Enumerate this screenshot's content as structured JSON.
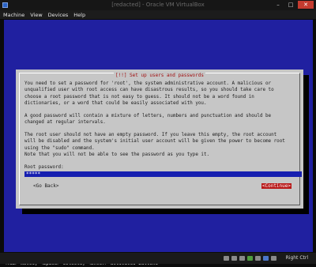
{
  "window": {
    "title": "[redacted] - Oracle VM VirtualBox",
    "controls": {
      "minimize": "–",
      "maximize": "□",
      "close": "✕"
    }
  },
  "menu": [
    "Machine",
    "View",
    "Devices",
    "Help"
  ],
  "dialog": {
    "title": "[!!] Set up users and passwords",
    "paragraphs": [
      "You need to set a password for 'root', the system administrative account. A malicious or unqualified user with root access can have disastrous results, so you should take care to choose a root password that is not easy to guess. It should not be a word found in dictionaries, or a word that could be easily associated with you.",
      "A good password will contain a mixture of letters, numbers and punctuation and should be changed at regular intervals.",
      "The root user should not have an empty password. If you leave this empty, the root account will be disabled and the system's initial user account will be given the power to become root using the \"sudo\" command.",
      "Note that you will not be able to see the password as you type it."
    ],
    "field_label": "Root password:",
    "field_value": "*****",
    "back_label": "<Go Back>",
    "continue_label": "<Continue>"
  },
  "status_line": "<Tab> moves; <Space> selects; <Enter> activates buttons",
  "host_key": "Right Ctrl",
  "colors": {
    "screen_bg": "#2020a0",
    "dialog_bg": "#c6c6c6",
    "title_red": "#a01010",
    "button_selected": "#b81818",
    "field_bg": "#161fb0"
  }
}
